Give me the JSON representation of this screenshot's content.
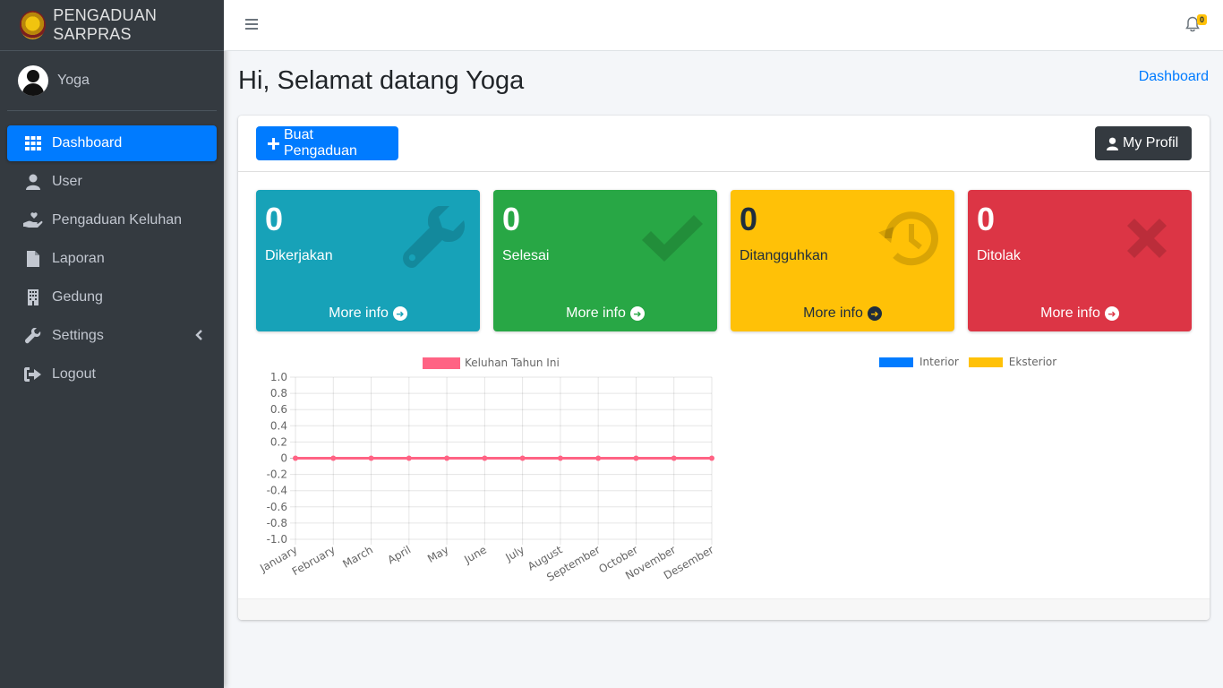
{
  "brand": {
    "title": "PENGADUAN SARPRAS"
  },
  "user": {
    "name": "Yoga"
  },
  "sidebar": {
    "items": [
      {
        "label": "Dashboard",
        "icon": "grid-icon"
      },
      {
        "label": "User",
        "icon": "user-icon"
      },
      {
        "label": "Pengaduan Keluhan",
        "icon": "hand-heart-icon"
      },
      {
        "label": "Laporan",
        "icon": "file-icon"
      },
      {
        "label": "Gedung",
        "icon": "building-icon"
      },
      {
        "label": "Settings",
        "icon": "wrench-icon"
      },
      {
        "label": "Logout",
        "icon": "logout-icon"
      }
    ]
  },
  "topbar": {
    "notification_count": "0"
  },
  "header": {
    "title": "Hi, Selamat datang Yoga",
    "breadcrumb": "Dashboard"
  },
  "toolbar": {
    "create_label": "Buat Pengaduan",
    "profile_label": "My Profil"
  },
  "stats": [
    {
      "count": "0",
      "label": "Dikerjakan",
      "more": "More info",
      "icon": "wrench-icon",
      "color": "#17a2b8"
    },
    {
      "count": "0",
      "label": "Selesai",
      "more": "More info",
      "icon": "check-icon",
      "color": "#28a745"
    },
    {
      "count": "0",
      "label": "Ditangguhkan",
      "more": "More info",
      "icon": "history-icon",
      "color": "#ffc107"
    },
    {
      "count": "0",
      "label": "Ditolak",
      "more": "More info",
      "icon": "close-icon",
      "color": "#dc3545"
    }
  ],
  "chart_data": [
    {
      "type": "line",
      "categories": [
        "January",
        "February",
        "March",
        "April",
        "May",
        "June",
        "July",
        "August",
        "September",
        "October",
        "November",
        "Desember"
      ],
      "series": [
        {
          "name": "Keluhan Tahun Ini",
          "values": [
            0,
            0,
            0,
            0,
            0,
            0,
            0,
            0,
            0,
            0,
            0,
            0
          ],
          "color": "#ff6384"
        }
      ],
      "yticks": [
        "1.0",
        "0.8",
        "0.6",
        "0.4",
        "0.2",
        "0",
        "-0.2",
        "-0.4",
        "-0.6",
        "-0.8",
        "-1.0"
      ],
      "ylim": [
        -1,
        1
      ],
      "grid": true,
      "legend": "top"
    },
    {
      "type": "pie",
      "series": [
        {
          "name": "Interior",
          "values": [],
          "color": "#007bff"
        },
        {
          "name": "Eksterior",
          "values": [],
          "color": "#ffc107"
        }
      ],
      "legend": "top"
    }
  ]
}
